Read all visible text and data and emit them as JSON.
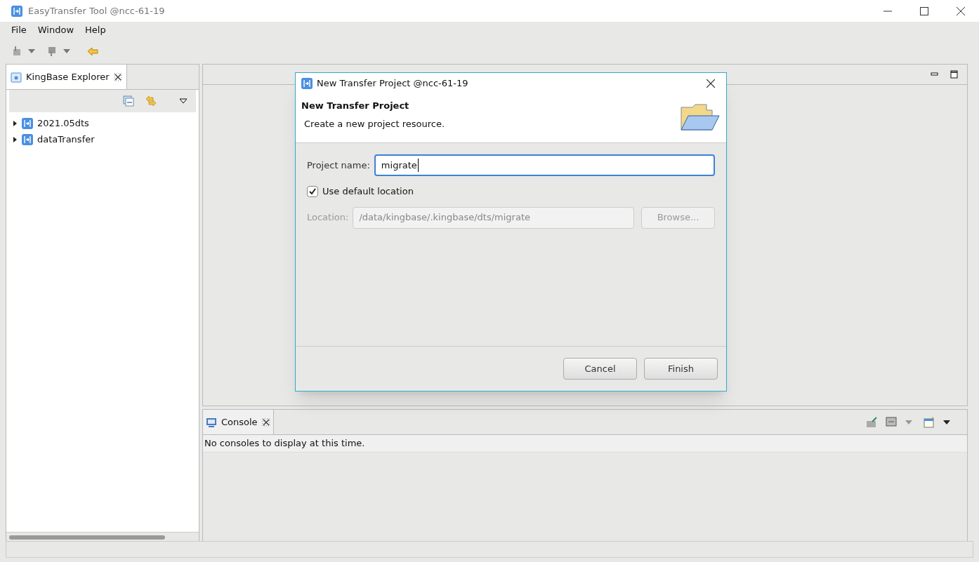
{
  "window": {
    "title": "EasyTransfer Tool @ncc-61-19"
  },
  "menu": [
    "File",
    "Window",
    "Help"
  ],
  "explorer": {
    "tab": "KingBase Explorer",
    "tree": [
      {
        "label": "2021.05dts",
        "expanded": false
      },
      {
        "label": "dataTransfer",
        "expanded": false
      }
    ]
  },
  "console": {
    "tab": "Console",
    "message": "No consoles to display at this time."
  },
  "dialog": {
    "title": "New Transfer Project @ncc-61-19",
    "heading": "New Transfer Project",
    "description": "Create a new project resource.",
    "project_name": {
      "label": "Project name:",
      "value": "migrate"
    },
    "default_location": {
      "label": "Use default location",
      "checked": true
    },
    "location": {
      "label": "Location:",
      "value": "/data/kingbase/.kingbase/dts/migrate",
      "disabled": true
    },
    "browse": {
      "label": "Browse...",
      "disabled": true
    },
    "buttons": [
      "Cancel",
      "Finish"
    ]
  }
}
